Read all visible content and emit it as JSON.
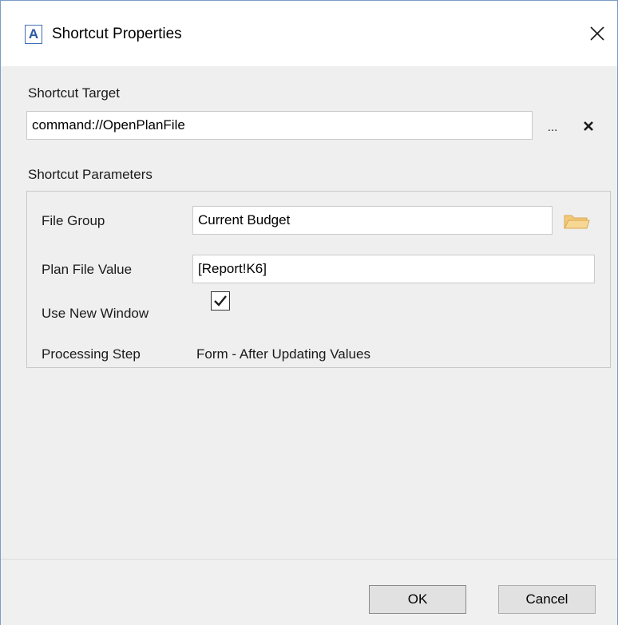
{
  "window": {
    "app_icon_letter": "A",
    "title": "Shortcut Properties"
  },
  "target": {
    "label": "Shortcut Target",
    "value": "command://OpenPlanFile",
    "browse_label": "..."
  },
  "parameters": {
    "label": "Shortcut Parameters",
    "file_group": {
      "label": "File Group",
      "value": "Current Budget"
    },
    "plan_file_value": {
      "label": "Plan File Value",
      "value": "[Report!K6]"
    },
    "use_new_window": {
      "label": "Use New Window",
      "checked": true
    },
    "processing_step": {
      "label": "Processing Step",
      "value": "Form - After Updating Values"
    }
  },
  "footer": {
    "ok_label": "OK",
    "cancel_label": "Cancel"
  },
  "colors": {
    "client_bg": "#efefef",
    "icon_blue": "#2a5aa6",
    "folder_yellow": "#f2c97a"
  }
}
